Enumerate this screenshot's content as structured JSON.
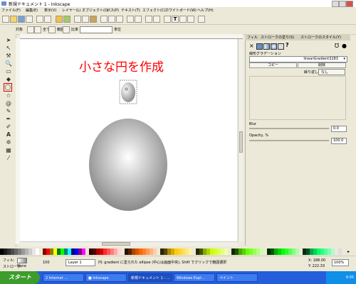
{
  "window": {
    "title": "新規ドキュメント 1 - Inkscape"
  },
  "menubar": {
    "items": [
      "ファイル(F)",
      "編集(E)",
      "表示(V)",
      "レイヤー(L)",
      "オブジェクト(O)",
      "パス(P)",
      "テキスト(T)",
      "エフェクト(C)",
      "ホワイトボード(W)",
      "ヘルプ(H)"
    ]
  },
  "ctlbar": {
    "labels": [
      "対象",
      "全て",
      "範囲",
      "比率",
      "単位"
    ]
  },
  "canvas": {
    "annotation": "小さな円を作成"
  },
  "panel": {
    "tabs": [
      "フィル",
      "ストロークの塗り(S)",
      "ストロークのスタイル(Y)"
    ],
    "gradient_label": "線形グラデーション",
    "gradient_value": "linearGradient3283",
    "buttons": [
      "コピー",
      "削除"
    ],
    "repeat_label": "繰り返し:",
    "repeat_value": "なし",
    "blur_label": "Blur",
    "blur_value": "0.0",
    "opacity_label": "Opacity, %",
    "opacity_value": "100.0"
  },
  "statusbar": {
    "fill_label": "フィル:",
    "stroke_label": "ストローク:",
    "stroke_value": "None",
    "opacity": "100",
    "layer": "Layer 1",
    "hint": "円: gradient に塗られた ellipse (中心は画面中央), Shift でクリックで範囲選択",
    "coord_x": "X: 188.00",
    "coord_y": "Y: 222.33",
    "zoom": "100%"
  },
  "taskbar": {
    "start": "スタート",
    "tasks": [
      "2 Internet …",
      "■ Inkscape",
      "新規ドキュメント 1 - …",
      "Windows Expl…",
      "ペイント"
    ],
    "clock": "9:05"
  },
  "colors": {
    "accent": "#ff0000",
    "selection_outline": "#cc0000",
    "gradient_light": "#ffffff",
    "gradient_dark": "#8a8a8a"
  }
}
